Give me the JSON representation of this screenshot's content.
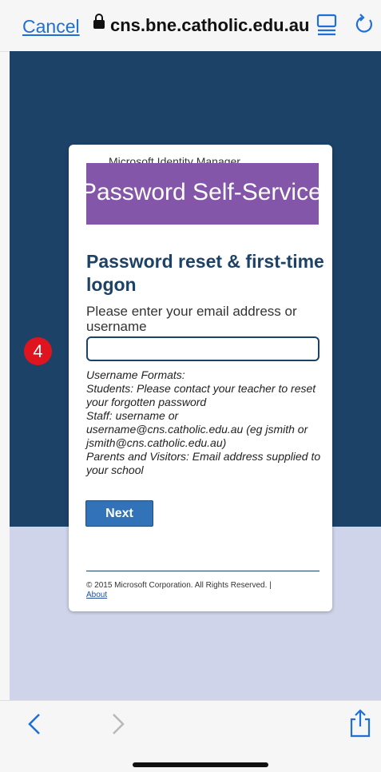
{
  "browser": {
    "cancel_label": "Cancel",
    "url": "cns.bne.catholic.edu.au",
    "icons": {
      "lock": "lock-icon",
      "reader": "reader-mode-icon",
      "reload": "reload-icon"
    }
  },
  "card": {
    "product_name": "Microsoft Identity Manager",
    "banner_text": "Password Self-Service",
    "heading": "Password reset & first-time logon",
    "prompt": "Please enter your email address or username",
    "input_value": "",
    "formats": [
      "Username Formats:",
      "Students: Please contact your teacher to reset your forgotten password",
      "Staff: username or username@cns.catholic.edu.au (eg jsmith or jsmith@cns.catholic.edu.au)",
      "Parents and Visitors: Email address supplied to your school"
    ],
    "next_label": "Next",
    "copyright": "© 2015 Microsoft Corporation. All Rights Reserved. |",
    "about_link": "About"
  },
  "badge": {
    "number": "4"
  },
  "toolbar": {
    "icons": [
      "back-icon",
      "forward-icon",
      "share-icon"
    ]
  },
  "colors": {
    "page_blue": "#1c4268",
    "lavender": "#cfd4ea",
    "banner_purple": "#8456a9",
    "button_blue": "#3172b8",
    "badge_red": "#e0141e",
    "link_blue": "#1f6fd6"
  }
}
